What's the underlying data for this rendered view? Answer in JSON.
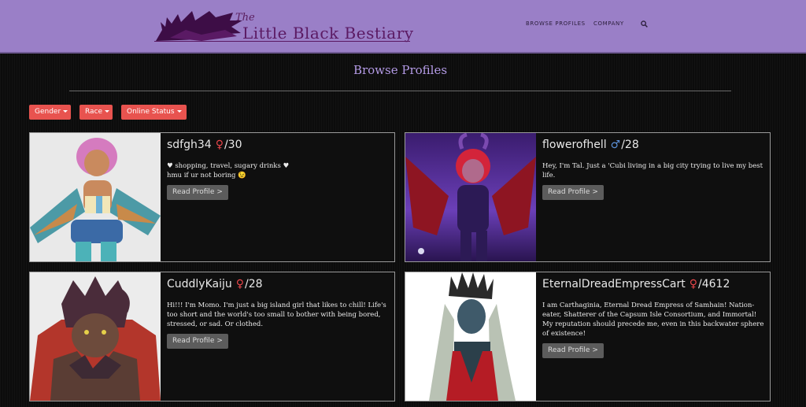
{
  "site": {
    "logo_the": "The",
    "logo_text": "Little Black Bestiary"
  },
  "nav": {
    "browse": "BROWSE PROFILES",
    "company": "COMPANY",
    "search_icon": "search-icon"
  },
  "page": {
    "title": "Browse Profiles"
  },
  "filters": {
    "gender": "Gender",
    "race": "Race",
    "online": "Online Status"
  },
  "profiles": [
    {
      "name": "sdfgh34",
      "gender": "♀",
      "age": "/30",
      "bio": "♥ shopping, travel, sugary drinks ♥\nhmu if ur not boring 😉",
      "read_label": "Read Profile >"
    },
    {
      "name": "flowerofhell",
      "gender": "♂",
      "age": "/28",
      "bio": "Hey, I'm Tal. Just a 'Cubi living in a big city trying to live my best life.",
      "read_label": "Read Profile >"
    },
    {
      "name": "CuddlyKaiju",
      "gender": "♀",
      "age": "/28",
      "bio": "Hi!!! I'm Momo. I'm just a big island girl that likes to chill! Life's too short and the world's too small to bother with being bored, stressed, or sad. Or clothed.",
      "read_label": "Read Profile >"
    },
    {
      "name": "EternalDreadEmpressCart",
      "gender": "♀",
      "age": "/4612",
      "bio": "I am Carthaginia, Eternal Dread Empress of Samhain! Nation-eater, Shatterer of the Capsum Isle Consortium, and Immortal! My reputation should precede me, even in this backwater sphere of existence!",
      "read_label": "Read Profile >"
    }
  ]
}
